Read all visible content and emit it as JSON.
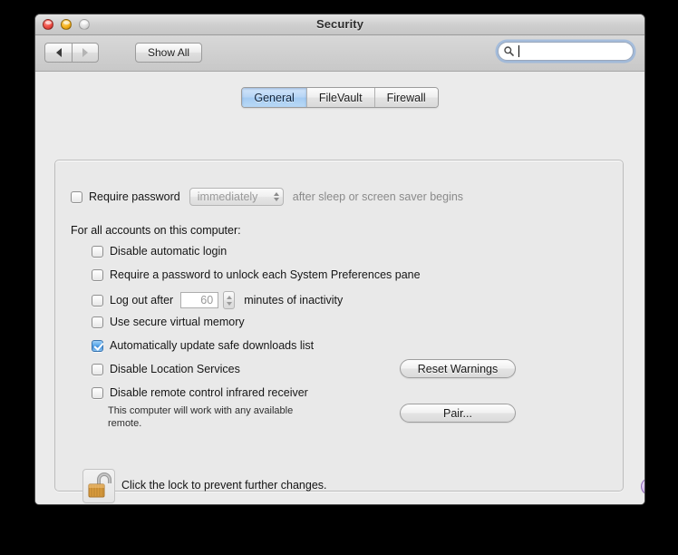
{
  "window": {
    "title": "Security",
    "traffic_lights": [
      "close",
      "minimize",
      "zoom"
    ]
  },
  "toolbar": {
    "back_label": "◀",
    "forward_label": "▶",
    "show_all_label": "Show All",
    "search": {
      "value": "",
      "placeholder": ""
    }
  },
  "tabs": [
    {
      "label": "General",
      "selected": true
    },
    {
      "label": "FileVault",
      "selected": false
    },
    {
      "label": "Firewall",
      "selected": false
    }
  ],
  "general": {
    "require_password": {
      "checked": false,
      "label": "Require password",
      "popup_value": "immediately",
      "trailing_text": "after sleep or screen saver begins"
    },
    "section_label": "For all accounts on this computer:",
    "options": [
      {
        "label": "Disable automatic login",
        "checked": false
      },
      {
        "label": "Require a password to unlock each System Preferences pane",
        "checked": false
      },
      {
        "label": "Log out after",
        "checked": false,
        "field_value": "60",
        "trailing_text": "minutes of inactivity"
      },
      {
        "label": "Use secure virtual memory",
        "checked": false
      },
      {
        "label": "Automatically update safe downloads list",
        "checked": true
      },
      {
        "label": "Disable Location Services",
        "checked": false
      },
      {
        "label": "Disable remote control infrared receiver",
        "checked": false
      }
    ],
    "remote_helper_text": "This computer will work with any available remote.",
    "reset_warnings_label": "Reset Warnings",
    "pair_label": "Pair..."
  },
  "footer": {
    "lock_icon": "unlocked-padlock-icon",
    "lock_text": "Click the lock to prevent further changes.",
    "help_label": "?"
  },
  "colors": {
    "accent_blue": "#4f98e0",
    "help_purple": "#b693da",
    "lock_gold": "#d99b3c"
  }
}
